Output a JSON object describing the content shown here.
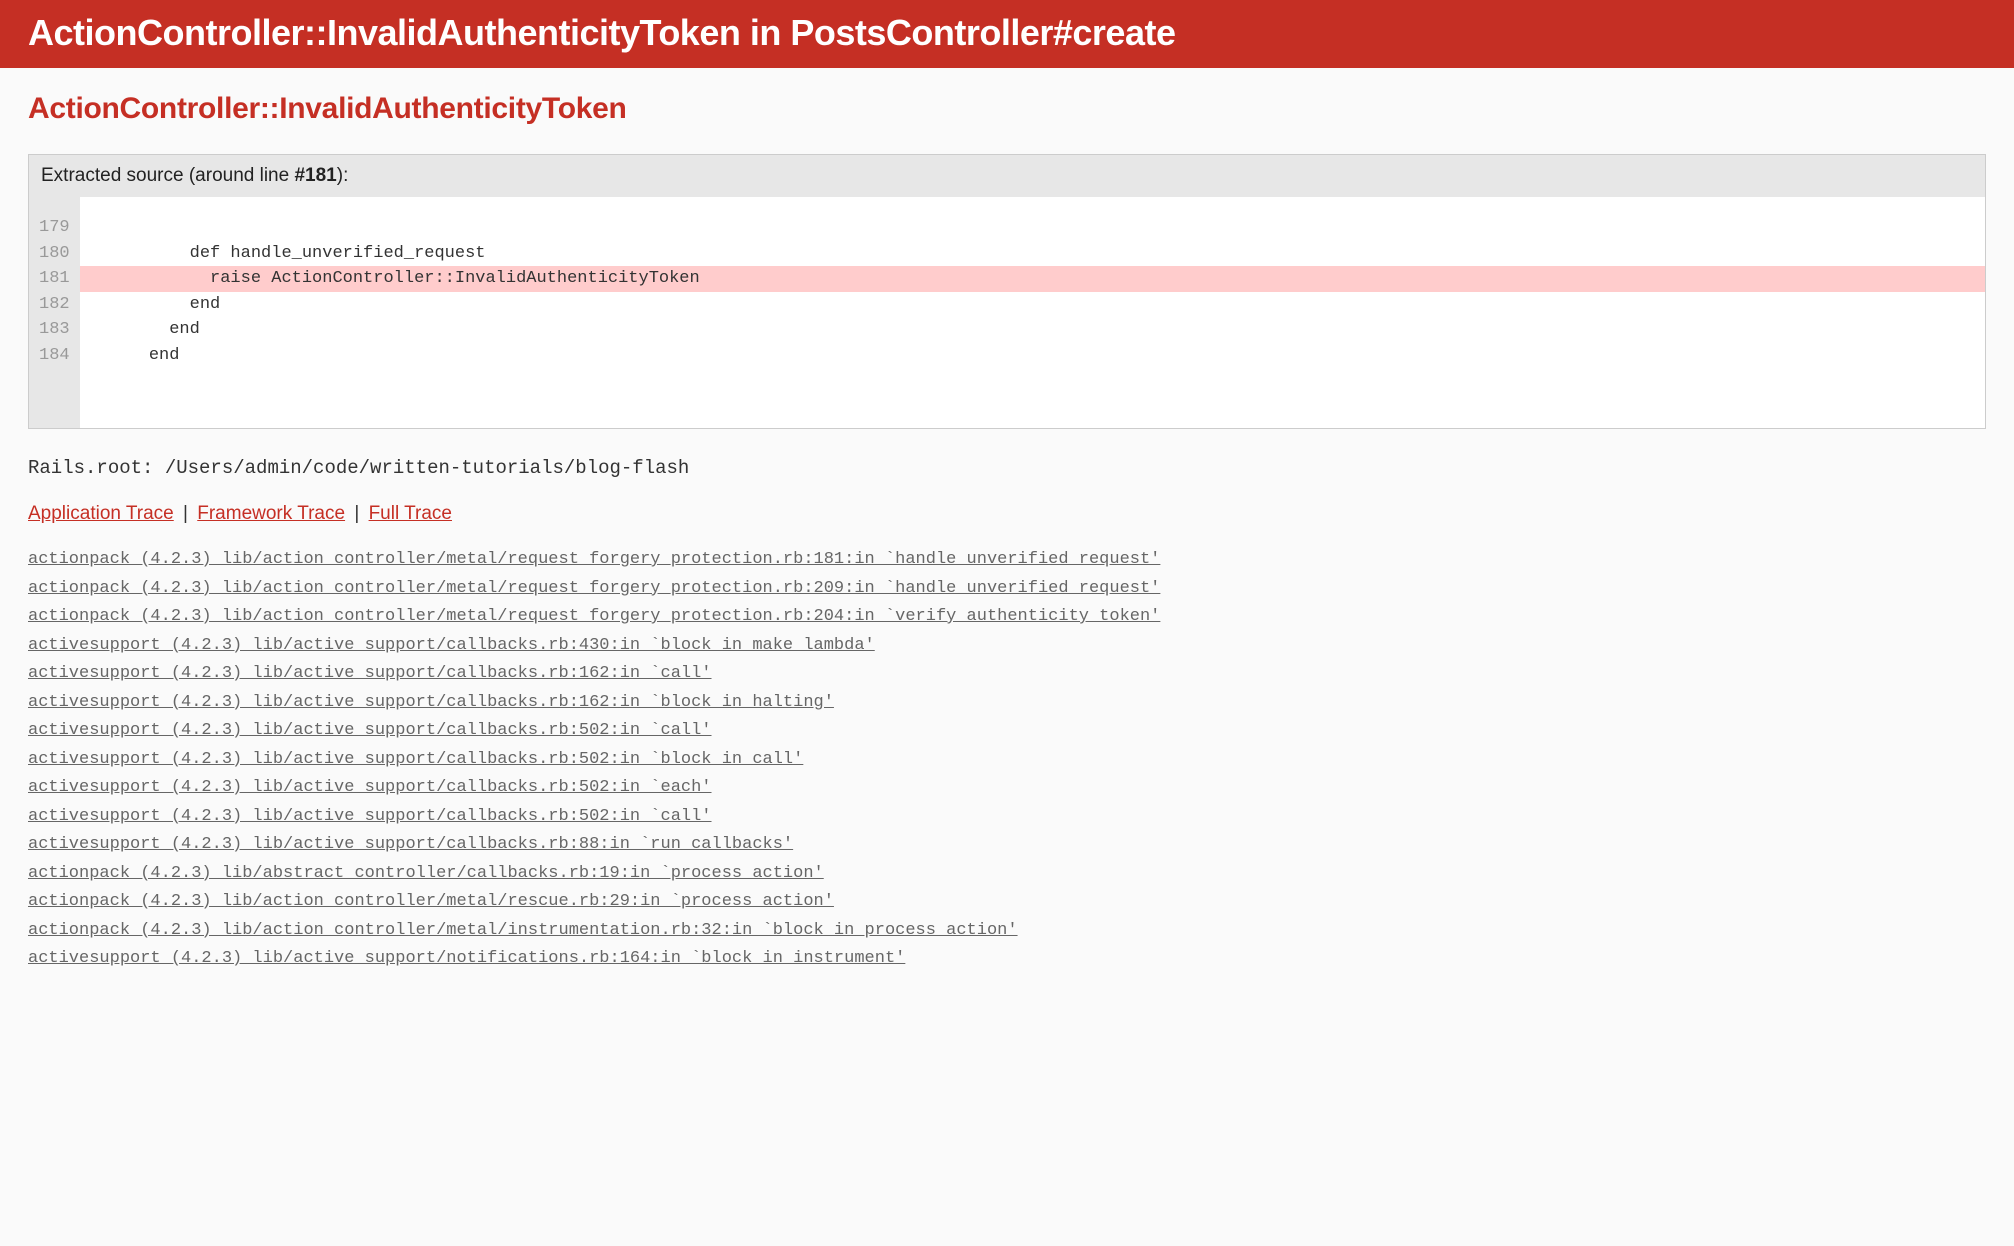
{
  "header": {
    "title": "ActionController::InvalidAuthenticityToken in PostsController#create"
  },
  "exception_title": "ActionController::InvalidAuthenticityToken",
  "source": {
    "header_prefix": "Extracted source (around line ",
    "header_line": "#181",
    "header_suffix": "):",
    "lines": [
      {
        "num": "179",
        "code": "",
        "hl": false
      },
      {
        "num": "180",
        "code": "          def handle_unverified_request",
        "hl": false
      },
      {
        "num": "181",
        "code": "            raise ActionController::InvalidAuthenticityToken",
        "hl": true
      },
      {
        "num": "182",
        "code": "          end",
        "hl": false
      },
      {
        "num": "183",
        "code": "        end",
        "hl": false
      },
      {
        "num": "184",
        "code": "      end",
        "hl": false
      }
    ]
  },
  "rails_root": "Rails.root: /Users/admin/code/written-tutorials/blog-flash",
  "trace_tabs": {
    "application": "Application Trace",
    "framework": "Framework Trace",
    "full": "Full Trace"
  },
  "trace_lines": [
    "actionpack (4.2.3) lib/action_controller/metal/request_forgery_protection.rb:181:in `handle_unverified_request'",
    "actionpack (4.2.3) lib/action_controller/metal/request_forgery_protection.rb:209:in `handle_unverified_request'",
    "actionpack (4.2.3) lib/action_controller/metal/request_forgery_protection.rb:204:in `verify_authenticity_token'",
    "activesupport (4.2.3) lib/active_support/callbacks.rb:430:in `block in make_lambda'",
    "activesupport (4.2.3) lib/active_support/callbacks.rb:162:in `call'",
    "activesupport (4.2.3) lib/active_support/callbacks.rb:162:in `block in halting'",
    "activesupport (4.2.3) lib/active_support/callbacks.rb:502:in `call'",
    "activesupport (4.2.3) lib/active_support/callbacks.rb:502:in `block in call'",
    "activesupport (4.2.3) lib/active_support/callbacks.rb:502:in `each'",
    "activesupport (4.2.3) lib/active_support/callbacks.rb:502:in `call'",
    "activesupport (4.2.3) lib/active_support/callbacks.rb:88:in `run_callbacks'",
    "actionpack (4.2.3) lib/abstract_controller/callbacks.rb:19:in `process_action'",
    "actionpack (4.2.3) lib/action_controller/metal/rescue.rb:29:in `process_action'",
    "actionpack (4.2.3) lib/action_controller/metal/instrumentation.rb:32:in `block in process_action'",
    "activesupport (4.2.3) lib/active_support/notifications.rb:164:in `block in instrument'"
  ]
}
